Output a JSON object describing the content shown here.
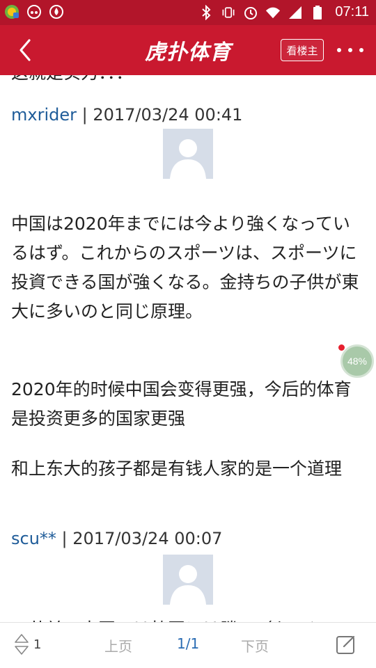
{
  "status_bar": {
    "time": "07:11",
    "icons": [
      "notification-app-icon",
      "game-controller-icon",
      "water-drop-icon",
      "bluetooth-icon",
      "vibrate-icon",
      "alarm-icon",
      "wifi-icon",
      "signal-icon",
      "battery-icon"
    ]
  },
  "app_bar": {
    "back_icon": "chevron-left-icon",
    "logo_text": "虎扑体育",
    "only_op_label": "看楼主",
    "more_icon": "more-dots-icon"
  },
  "content": {
    "partial_top_text": "这就是实力：：：",
    "posts": [
      {
        "user": "mxrider",
        "separator": " | ",
        "time": "2017/03/24 00:41",
        "paragraphs": [
          "中国は2020年までには今より強くなっているはず。これからのスポーツは、スポーツに投資できる国が強くなる。金持ちの子供が東大に多いのと同じ原理。",
          "2020年的时候中国会变得更强，今后的体育是投资更多的国家更强",
          "和上东大的孩子都是有钱人家的是一个道理"
        ]
      },
      {
        "user": "scu**",
        "separator": " | ",
        "time": "2017/03/24 00:07",
        "paragraphs": [
          "…共並　中国　は韓国には勝…（をいと…"
        ]
      }
    ]
  },
  "progress_indicator": {
    "value_label": "48%",
    "value": 0.48
  },
  "bottom_bar": {
    "vote_count": "1",
    "prev_label": "上页",
    "page_label": "1/1",
    "next_label": "下页",
    "edit_icon": "edit-icon"
  },
  "colors": {
    "status_bar": "#b2152a",
    "app_bar": "#c9192f",
    "username": "#1f5c99",
    "current_page": "#2a6cb3"
  }
}
